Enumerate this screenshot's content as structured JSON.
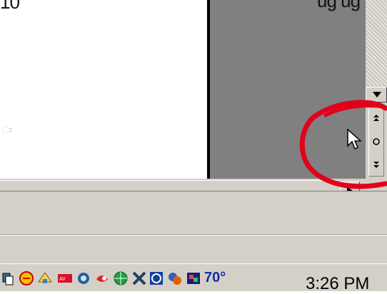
{
  "document": {
    "top_fragment": "10",
    "margin_mark": "ઃ",
    "gutter_fragment": "ug ug"
  },
  "scrollbar": {
    "scroll_down_icon": "triangle-down-icon",
    "prev_page_label": "⯭",
    "browse_object_label": "○",
    "next_page_label": "⯯"
  },
  "annotation": {
    "circle_color": "#e3001b"
  },
  "taskbar": {
    "tray_icons": [
      "network-icon",
      "antivirus-icon",
      "hardware-icon",
      "mcafee-icon",
      "volume-icon",
      "messenger-icon",
      "globe-icon",
      "tools-icon",
      "sync-icon",
      "updates-icon",
      "media-icon",
      "weather-icon"
    ],
    "clock": "3:26 PM",
    "weather_temp": "70°"
  }
}
